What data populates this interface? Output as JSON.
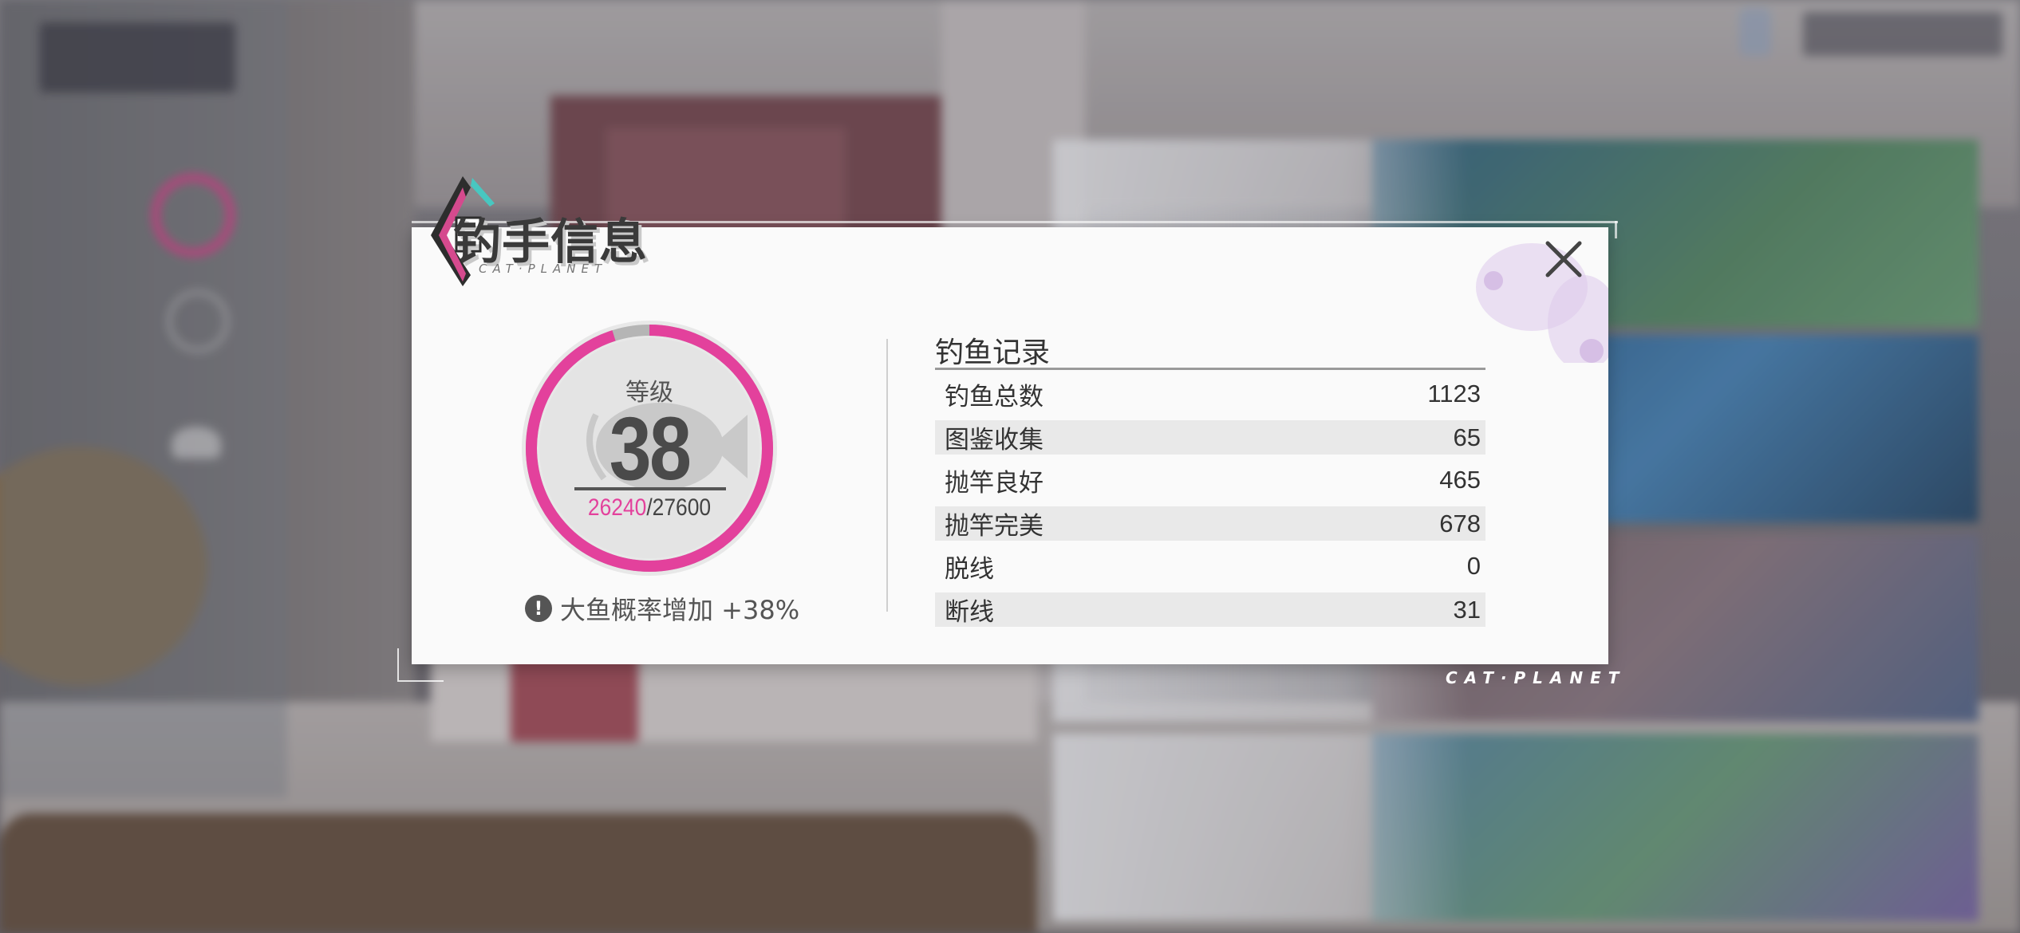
{
  "dialog": {
    "title": "钓手信息",
    "title_sub": "CAT·PLANET",
    "brand_bottom": "CAT·PLANET"
  },
  "level": {
    "label": "等级",
    "value": "38",
    "exp_current": "26240",
    "exp_separator": "/",
    "exp_max": "27600",
    "progress": 0.951,
    "bonus_icon_glyph": "!",
    "bonus_text": "大鱼概率增加 +38%"
  },
  "records": {
    "title": "钓鱼记录",
    "rows": [
      {
        "label": "钓鱼总数",
        "value": "1123"
      },
      {
        "label": "图鉴收集",
        "value": "65"
      },
      {
        "label": "抛竿良好",
        "value": "465"
      },
      {
        "label": "抛竿完美",
        "value": "678"
      },
      {
        "label": "脱线",
        "value": "0"
      },
      {
        "label": "断线",
        "value": "31"
      }
    ]
  },
  "colors": {
    "accent": "#e3419c",
    "ring_track": "#b5b5b5",
    "dialog_bg": "#fafafa",
    "text": "#333333"
  },
  "icons": {
    "close": "close-icon",
    "bonus": "info-icon",
    "emblem": "fish-emblem-icon"
  }
}
